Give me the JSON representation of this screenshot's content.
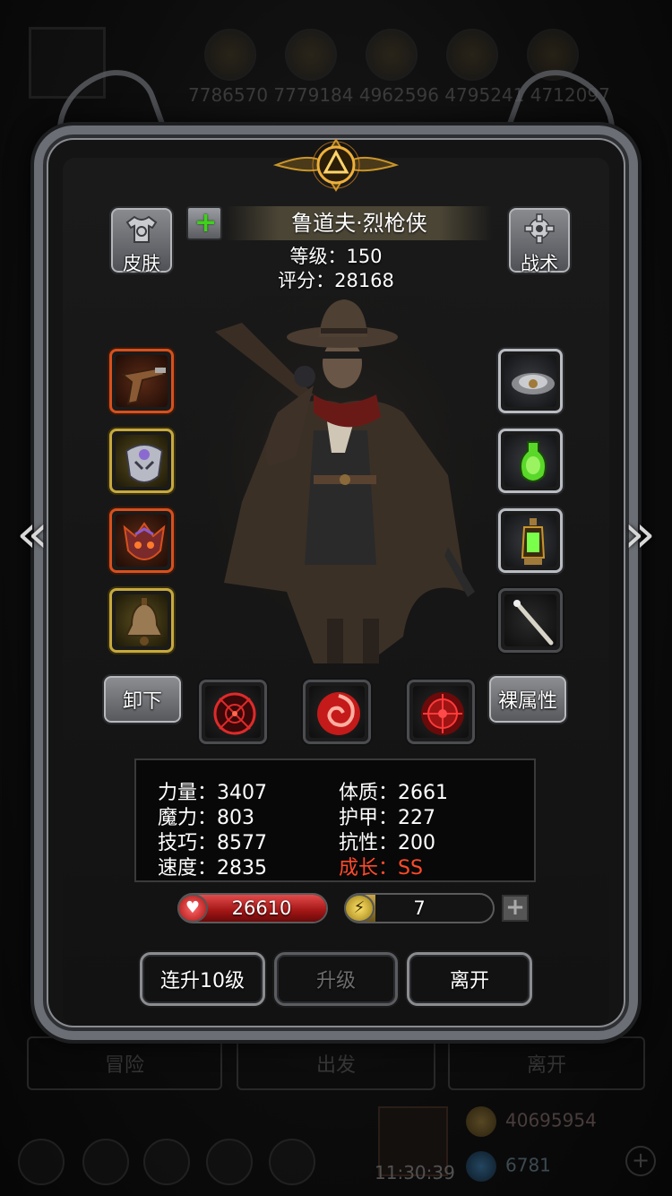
{
  "background": {
    "top_numbers": "7786570  7779184  4962596  4795241  4712097",
    "bottom_buttons": [
      "冒险",
      "出发",
      "离开"
    ],
    "clock": "11:30:39",
    "gold": "40695954",
    "gems": "6781"
  },
  "header": {
    "skin_label": "皮肤",
    "tactics_label": "战术",
    "hero_name": "鲁道夫·烈枪侠",
    "level_text": "等级：150",
    "score_text": "评分：28168"
  },
  "equipment": {
    "left_slots": [
      {
        "icon": "flintlock-pistol-icon",
        "rarity": "orange"
      },
      {
        "icon": "armor-helm-icon",
        "rarity": "gold"
      },
      {
        "icon": "demon-emblem-icon",
        "rarity": "orange"
      },
      {
        "icon": "bronze-bell-icon",
        "rarity": "gold"
      }
    ],
    "right_slots": [
      {
        "icon": "cloud-ring-icon",
        "rarity": "grey"
      },
      {
        "icon": "green-potion-icon",
        "rarity": "grey"
      },
      {
        "icon": "lantern-icon",
        "rarity": "grey"
      },
      {
        "icon": "bone-staff-icon",
        "rarity": "grey"
      }
    ],
    "unequip_label": "卸下",
    "base_stats_label": "裸属性",
    "skills": [
      "crosshair-skill-icon",
      "vortex-skill-icon",
      "target-skill-icon"
    ]
  },
  "stats": {
    "strength": "力量：3407",
    "magic": "魔力：803",
    "skill": "技巧：8577",
    "speed": "速度：2835",
    "constitution": "体质：2661",
    "armor": "护甲：227",
    "resistance": "抗性：200",
    "growth": "成长：SS"
  },
  "bars": {
    "hp_value": "26610",
    "hp_fraction": 1.0,
    "energy_value": "7",
    "energy_fraction": 0.2
  },
  "actions": {
    "level_up_10": "连升10级",
    "level_up": "升级",
    "leave": "离开"
  },
  "colors": {
    "growth": "#ff4a2a",
    "hp": "#c82020",
    "energy": "#c9a54a"
  }
}
